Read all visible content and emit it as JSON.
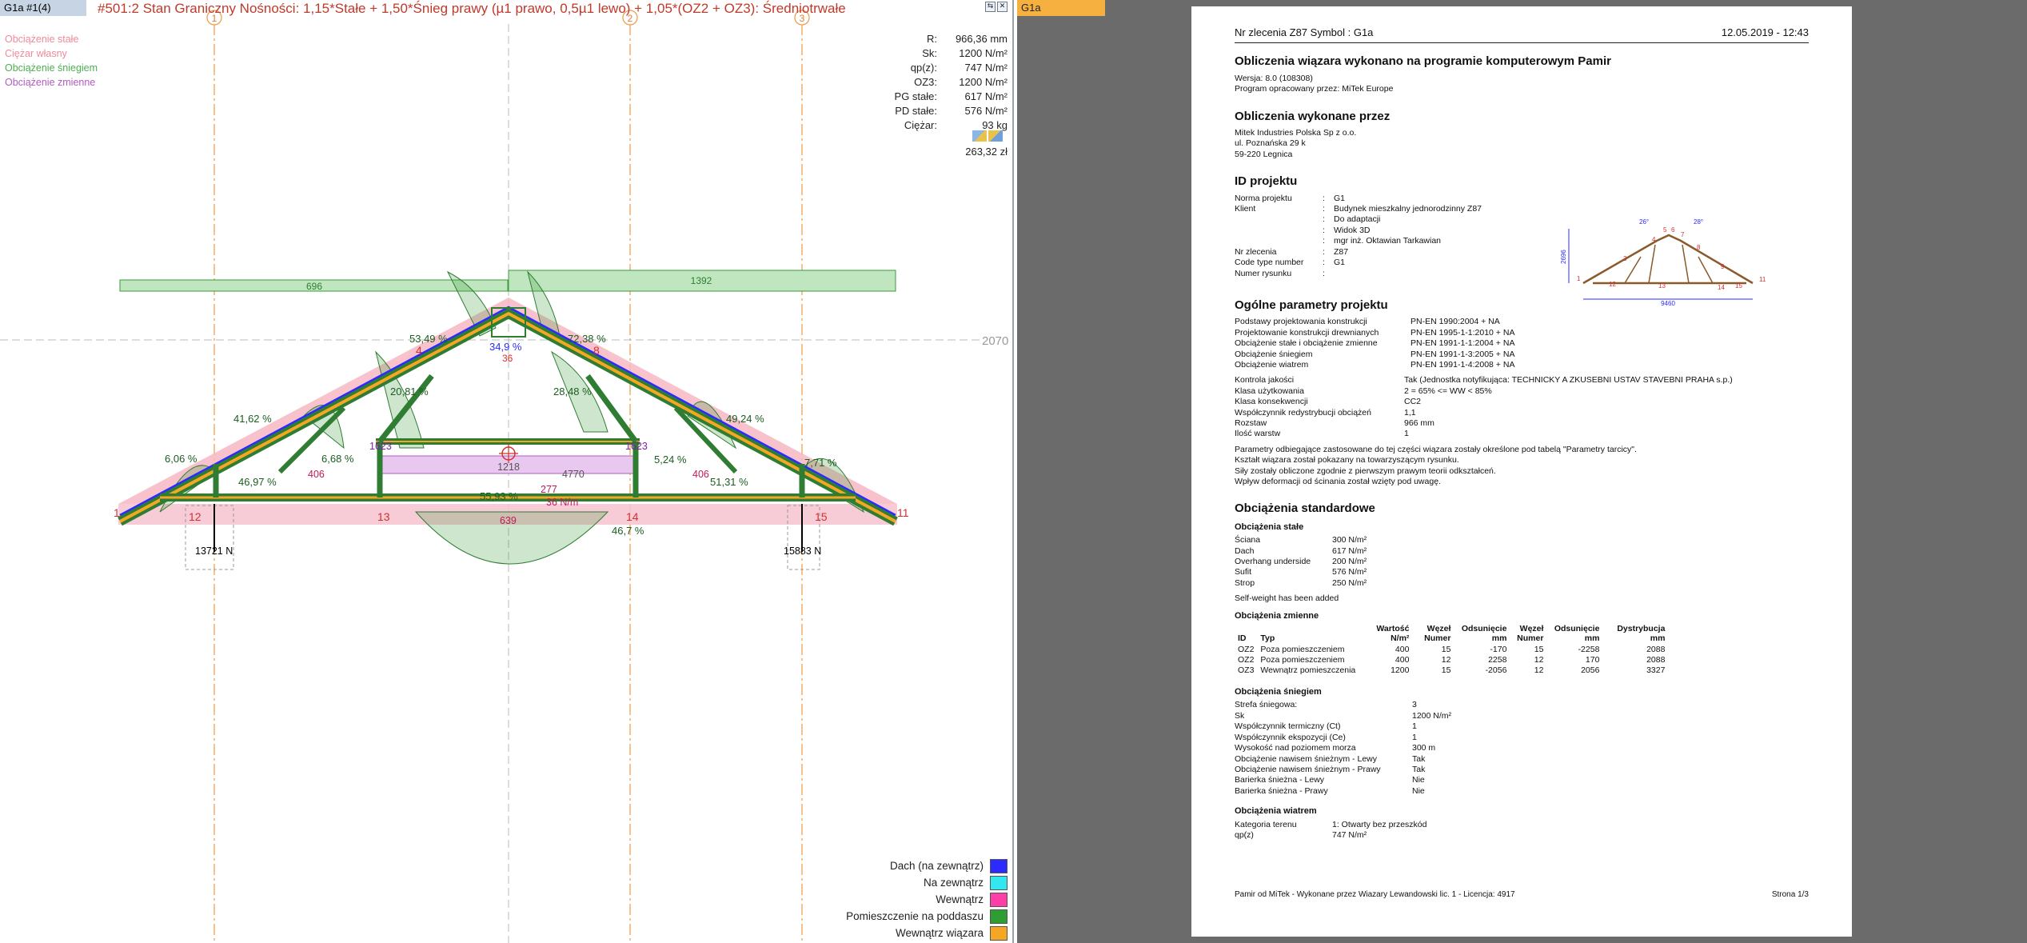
{
  "left": {
    "tab": "G1a #1(4)",
    "combo_title": "#501:2 Stan Graniczny Nośności: 1,15*Stałe + 1,50*Śnieg prawy (µ1 prawo, 0,5µ1 lewo) + 1,05*(OZ2 + OZ3): Średniotrwałe",
    "load_legend": [
      {
        "label": "Obciążenie stałe",
        "color": "#f08a99"
      },
      {
        "label": "Ciężar własny",
        "color": "#f08a99"
      },
      {
        "label": "Obciążenie śniegiem",
        "color": "#4caf50"
      },
      {
        "label": "Obciążenie zmienne",
        "color": "#b05cc0"
      }
    ],
    "params": [
      {
        "label": "R:",
        "value": "966,36 mm"
      },
      {
        "label": "Sk:",
        "value": "1200 N/m²"
      },
      {
        "label": "qp(z):",
        "value": "747 N/m²"
      },
      {
        "label": "OZ3:",
        "value": "1200 N/m²"
      },
      {
        "label": "PG stałe:",
        "value": "617 N/m²"
      },
      {
        "label": "PD stałe:",
        "value": "576 N/m²"
      },
      {
        "label": "Ciężar:",
        "value": "93 kg"
      }
    ],
    "price": "263,32 zł",
    "grid_labels": [
      "1",
      "2",
      "3"
    ],
    "height_label": "2070",
    "snow_left": "696",
    "snow_right": "1392",
    "percents": [
      "53,49 %",
      "72,38 %",
      "34,9 %",
      "41,62 %",
      "20,81 %",
      "28,48 %",
      "49,24 %",
      "6,06 %",
      "6,68 %",
      "5,24 %",
      "7,71 %",
      "46,97 %",
      "55,93 %",
      "51,31 %",
      "46,7 %"
    ],
    "loads": [
      "1623",
      "1623",
      "1218",
      "406",
      "406",
      "4770",
      "277",
      "36 N/m",
      "639"
    ],
    "supports": [
      "13721 N",
      "15883 N"
    ],
    "nodes": [
      "1",
      "4",
      "8",
      "11",
      "12",
      "13",
      "14",
      "15",
      "36"
    ],
    "material_legend": [
      {
        "label": "Dach (na zewnątrz)",
        "color": "#2b2bff"
      },
      {
        "label": "Na zewnątrz",
        "color": "#33e6f0"
      },
      {
        "label": "Wewnątrz",
        "color": "#ff3fa6"
      },
      {
        "label": "Pomieszczenie na poddaszu",
        "color": "#2f9e32"
      },
      {
        "label": "Wewnątrz wiązara",
        "color": "#f5a623"
      }
    ]
  },
  "right": {
    "tab": "G1a",
    "header_left": "Nr zlecenia Z87  Symbol : G1a",
    "header_right": "12.05.2019 - 12:43",
    "s1_title": "Obliczenia wiązara wykonano na programie komputerowym Pamir",
    "s1_lines": [
      "Wersja: 8.0 (108308)",
      "Program opracowany przez: MiTek Europe"
    ],
    "s2_title": "Obliczenia wykonane przez",
    "s2_lines": [
      "Mitek Industries Polska Sp z o.o.",
      "ul. Poznańska 29 k",
      "59-220 Legnica"
    ],
    "s3_title": "ID projektu",
    "project": [
      {
        "k": "Norma projektu",
        "v": "G1"
      },
      {
        "k": "Klient",
        "v": "Budynek mieszkalny jednorodzinny Z87"
      },
      {
        "k": "",
        "v": "Do adaptacji"
      },
      {
        "k": "",
        "v": "Widok 3D"
      },
      {
        "k": "",
        "v": "mgr inż. Oktawian Tarkawian"
      },
      {
        "k": "Nr zlecenia",
        "v": "Z87"
      },
      {
        "k": "Code type number",
        "v": "G1"
      },
      {
        "k": "Numer rysunku",
        "v": ""
      }
    ],
    "mini_truss": {
      "dim_h": "2696",
      "dim_w": "9460",
      "angle_l": "26°",
      "angle_r": "28°"
    },
    "s4_title": "Ogólne parametry projektu",
    "standards": [
      {
        "k": "Podstawy projektowania konstrukcji",
        "v": "PN-EN 1990:2004 + NA"
      },
      {
        "k": "Projektowanie konstrukcji drewnianych",
        "v": "PN-EN 1995-1-1:2010 + NA"
      },
      {
        "k": "Obciążenie stałe i obciążenie zmienne",
        "v": "PN-EN 1991-1-1:2004 + NA"
      },
      {
        "k": "Obciążenie śniegiem",
        "v": "PN-EN 1991-1-3:2005 + NA"
      },
      {
        "k": "Obciążenie wiatrem",
        "v": "PN-EN 1991-1-4:2008 + NA"
      }
    ],
    "quality": [
      {
        "k": "Kontrola jakości",
        "v": "Tak (Jednostka notyfikująca: TECHNICKY A ZKUSEBNI USTAV STAVEBNI PRAHA s.p.)"
      },
      {
        "k": "Klasa użytkowania",
        "v": "2 = 65% <= WW < 85%"
      },
      {
        "k": "Klasa konsekwencji",
        "v": "CC2"
      },
      {
        "k": "Współczynnik redystrybucji obciążeń",
        "v": "1,1"
      },
      {
        "k": "Rozstaw",
        "v": "966 mm"
      },
      {
        "k": "Ilość warstw",
        "v": "1"
      }
    ],
    "notes": [
      "Parametry odbiegające zastosowane do tej części wiązara zostały określone pod tabelą \"Parametry tarcicy\".",
      "Kształt wiązara został pokazany na towarzyszącym rysunku.",
      "Siły zostały obliczone zgodnie z pierwszym prawym teorii odkształceń.",
      "Wpływ deformacji od ścinania został wzięty pod uwagę."
    ],
    "s5_title": "Obciążenia standardowe",
    "perm_title": "Obciążenia stałe",
    "perm": [
      {
        "k": "Ściana",
        "v": "300 N/m²"
      },
      {
        "k": "Dach",
        "v": "617 N/m²"
      },
      {
        "k": "Overhang underside",
        "v": "200 N/m²"
      },
      {
        "k": "Sufit",
        "v": "576 N/m²"
      },
      {
        "k": "Strop",
        "v": "250 N/m²"
      }
    ],
    "selfweight": "Self-weight has been added",
    "var_title": "Obciążenia zmienne",
    "var_headers": [
      "ID",
      "Typ",
      "Wartość N/m²",
      "Węzeł Numer",
      "Odsunięcie mm",
      "Węzeł Numer",
      "Odsunięcie mm",
      "Dystrybucja mm"
    ],
    "var_rows": [
      [
        "OZ2",
        "Poza pomieszczeniem",
        "400",
        "15",
        "-170",
        "15",
        "-2258",
        "2088"
      ],
      [
        "OZ2",
        "Poza pomieszczeniem",
        "400",
        "12",
        "2258",
        "12",
        "170",
        "2088"
      ],
      [
        "OZ3",
        "Wewnątrz pomieszczenia",
        "1200",
        "15",
        "-2056",
        "12",
        "2056",
        "3327"
      ]
    ],
    "snow_title": "Obciążenia śniegiem",
    "snow": [
      {
        "k": "Strefa śniegowa:",
        "v": "3"
      },
      {
        "k": "Sk",
        "v": "1200 N/m²"
      },
      {
        "k": "Współczynnik termiczny (Ct)",
        "v": "1"
      },
      {
        "k": "Współczynnik ekspozycji (Ce)",
        "v": "1"
      },
      {
        "k": "Wysokość nad poziomem morza",
        "v": "300 m"
      },
      {
        "k": "Obciążenie nawisem śnieżnym - Lewy",
        "v": "Tak"
      },
      {
        "k": "Obciążenie nawisem śnieżnym - Prawy",
        "v": "Tak"
      },
      {
        "k": "Barierka śnieżna - Lewy",
        "v": "Nie"
      },
      {
        "k": "Barierka śnieżna - Prawy",
        "v": "Nie"
      }
    ],
    "wind_title": "Obciążenia wiatrem",
    "wind": [
      {
        "k": "Kategoria terenu",
        "v": "1: Otwarty bez przeszkód"
      },
      {
        "k": "qp(z)",
        "v": "747 N/m²"
      }
    ],
    "footer_left": "Pamir od MiTek - Wykonane przez Wiazary Lewandowski lic. 1 - Licencja: 4917",
    "footer_right": "Strona 1/3"
  }
}
